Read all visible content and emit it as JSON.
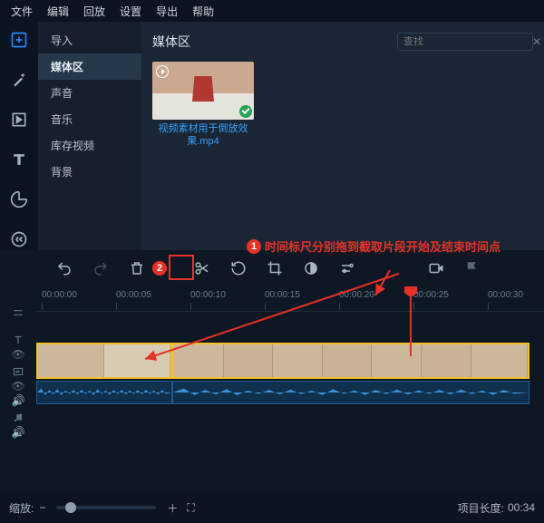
{
  "menu": {
    "items": [
      "文件",
      "编辑",
      "回放",
      "设置",
      "导出",
      "帮助"
    ]
  },
  "sidebar": {
    "items": [
      "导入",
      "媒体区",
      "声音",
      "音乐",
      "库存视频",
      "背景"
    ],
    "active_index": 1
  },
  "media": {
    "title": "媒体区",
    "search_placeholder": "查找",
    "clip_name": "视频素材用于倒放效果.mp4"
  },
  "annotation": {
    "badge1": "1",
    "text1": "时间标尺分别拖到截取片段开始及结束时间点",
    "badge2": "2"
  },
  "ruler": {
    "ticks": [
      "00:00:00",
      "00:00:05",
      "00:00:10",
      "00:00:15",
      "00:00:20",
      "00:00:25",
      "00:00:30"
    ]
  },
  "footer": {
    "zoom_label": "缩放:",
    "project_length_label": "项目长度:",
    "project_length_value": "00:34"
  }
}
